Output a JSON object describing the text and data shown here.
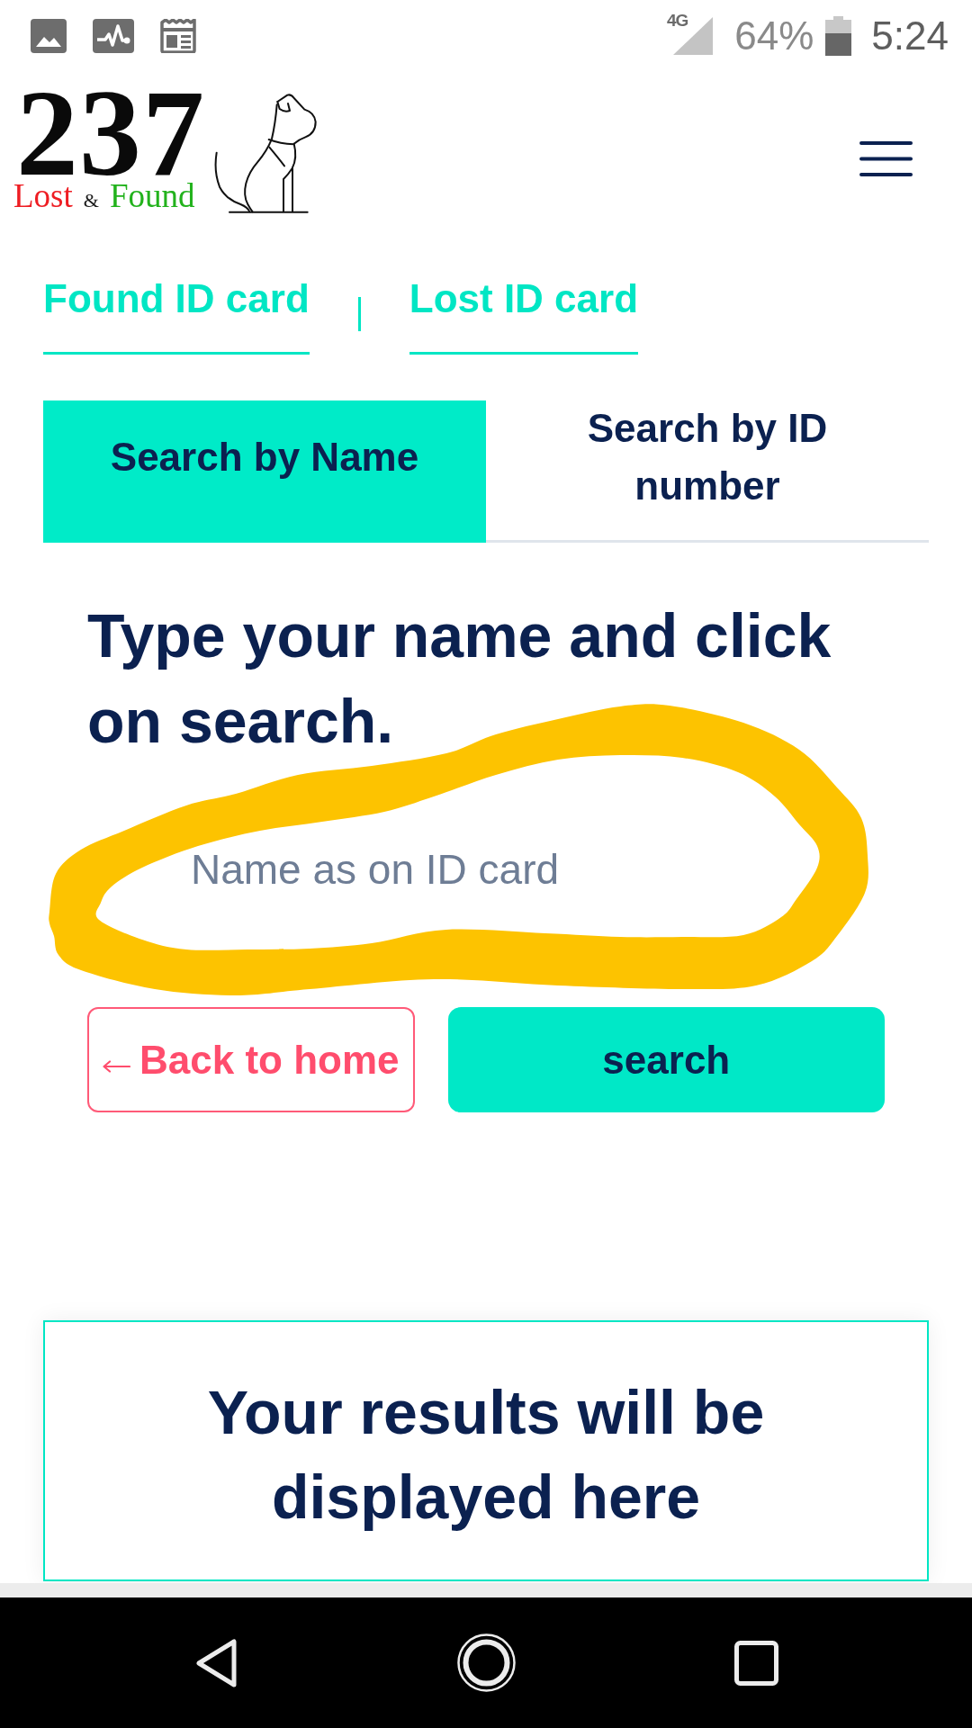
{
  "status_bar": {
    "network": "4G",
    "battery": "64%",
    "time": "5:24"
  },
  "header": {
    "logo": {
      "number": "237",
      "tagline": [
        {
          "kind": "word",
          "text": "Lost",
          "color": "#ee1d23"
        },
        {
          "kind": "symbol",
          "text": "&",
          "color": "#1a1a1a"
        },
        {
          "kind": "word",
          "text": "Found",
          "color": "#22b21c"
        }
      ]
    }
  },
  "links": [
    {
      "label": "Found ID card"
    },
    {
      "label": "Lost ID card"
    }
  ],
  "tabs": [
    {
      "label": "Search by Name",
      "selected": true
    },
    {
      "label": "Search by ID number",
      "selected": false
    }
  ],
  "form": {
    "heading": "Type your name and click on search.",
    "name_field": {
      "placeholder": "Name as on ID card"
    },
    "buttons": [
      {
        "kind": "back",
        "label": "Back to home"
      },
      {
        "kind": "search",
        "label": "search"
      }
    ]
  },
  "results": {
    "message": "Your results will be displayed here"
  }
}
